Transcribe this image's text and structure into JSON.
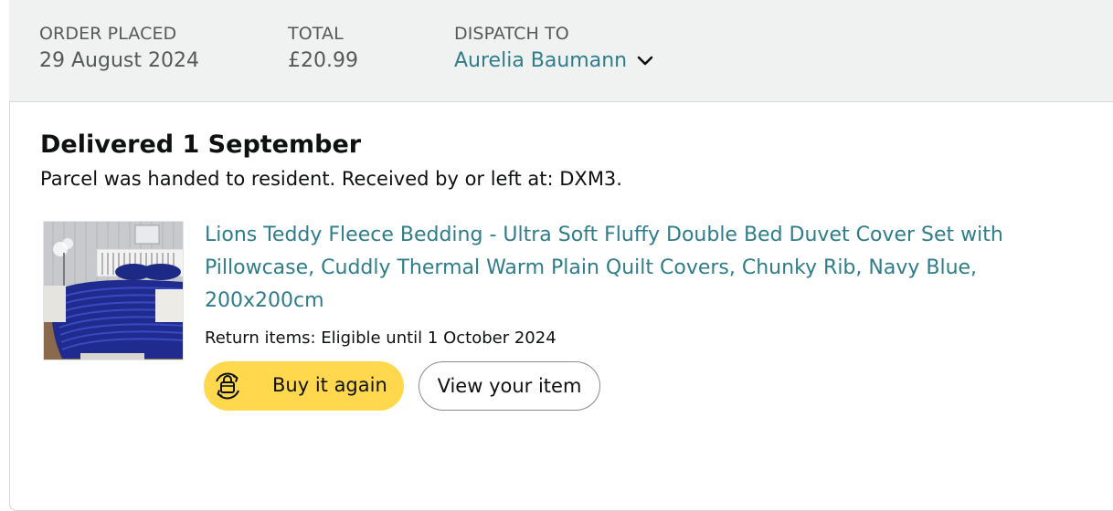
{
  "order_header": {
    "placed_label": "ORDER PLACED",
    "placed_value": "29 August 2024",
    "total_label": "TOTAL",
    "total_value": "£20.99",
    "dispatch_label": "DISPATCH TO",
    "dispatch_name": "Aurelia Baumann",
    "dispatch_icon": "chevron-down-icon"
  },
  "shipment": {
    "status_title": "Delivered 1 September",
    "status_detail": "Parcel was handed to resident. Received by or left at: DXM3."
  },
  "item": {
    "image": "product-image-navy-bedding",
    "title": "Lions Teddy Fleece Bedding - Ultra Soft Fluffy Double Bed Duvet Cover Set with Pillowcase, Cuddly Thermal Warm Plain Quilt Covers, Chunky Rib, Navy Blue, 200x200cm",
    "return_text": "Return items: Eligible until 1 October 2024"
  },
  "actions": {
    "buy_again_label": "Buy it again",
    "buy_again_icon": "buy-again-icon",
    "view_item_label": "View your item"
  },
  "colors": {
    "link": "#2f7d8a",
    "header_bg": "#f0f2f2",
    "buy_button": "#ffd84d",
    "text": "#0f1111",
    "muted": "#565959"
  }
}
